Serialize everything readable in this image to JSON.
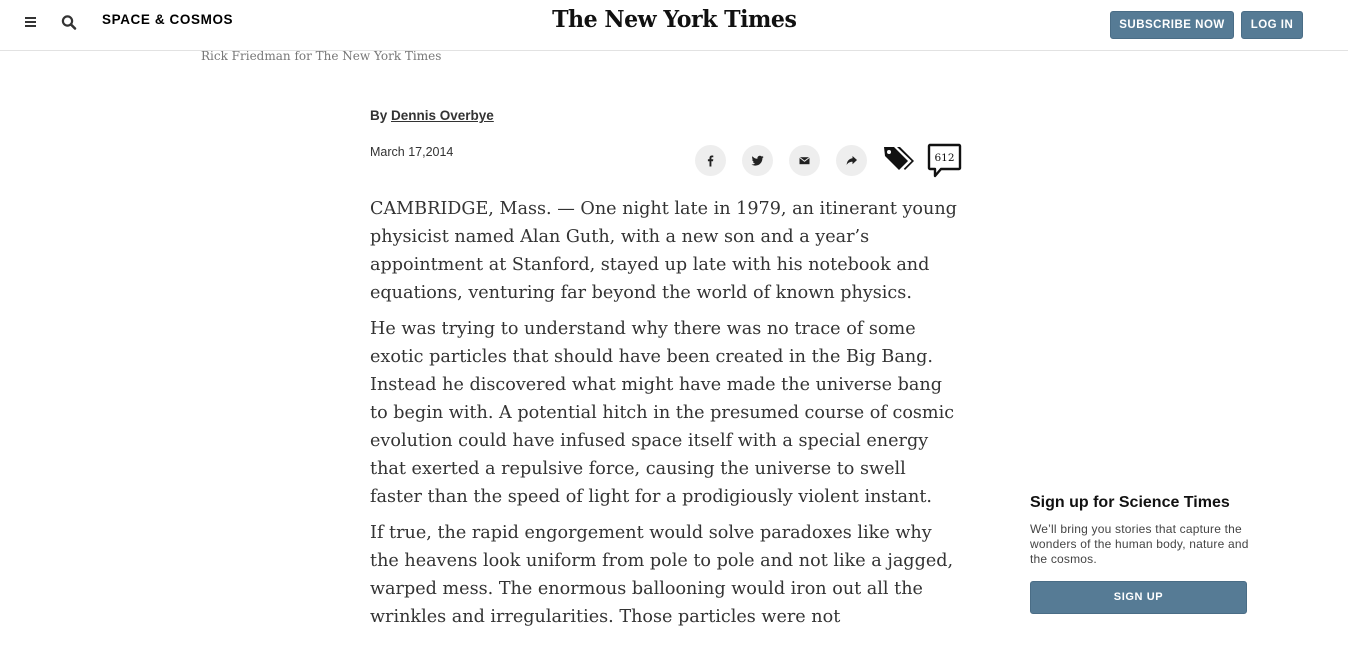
{
  "header": {
    "section": "SPACE & COSMOS",
    "masthead": "The New York Times",
    "subscribe_label": "SUBSCRIBE NOW",
    "login_label": "LOG IN"
  },
  "photo_credit": "Rick Friedman for The New York Times",
  "byline": {
    "prefix": "By ",
    "author": "Dennis Overbye"
  },
  "date": "March 17,2014",
  "comments_count": "612",
  "article": {
    "paragraphs": [
      "CAMBRIDGE, Mass. — One night late in 1979, an itinerant young physicist named Alan Guth, with a new son and a year’s appointment at Stanford, stayed up late with his notebook and equations, venturing far beyond the world of known physics.",
      "He was trying to understand why there was no trace of some exotic particles that should have been created in the Big Bang. Instead he discovered what might have made the universe bang to begin with. A potential hitch in the presumed course of cosmic evolution could have infused space itself with a special energy that exerted a repulsive force, causing the universe to swell faster than the speed of light for a prodigiously violent instant.",
      "If true, the rapid engorgement would solve paradoxes like why the heavens look uniform from pole to pole and not like a jagged, warped mess. The enormous ballooning would iron out all the wrinkles and irregularities. Those particles were not"
    ]
  },
  "signup": {
    "title": "Sign up for Science Times",
    "text": "We’ll bring you stories that capture the wonders of the human body, nature and the cosmos.",
    "button_label": "SIGN UP"
  },
  "colors": {
    "button_blue": "#567b95",
    "share_circle": "#eeeeee"
  },
  "icons": [
    "menu-icon",
    "search-icon",
    "facebook-icon",
    "twitter-icon",
    "email-icon",
    "share-arrow-icon",
    "tags-icon",
    "comment-bubble-icon"
  ]
}
